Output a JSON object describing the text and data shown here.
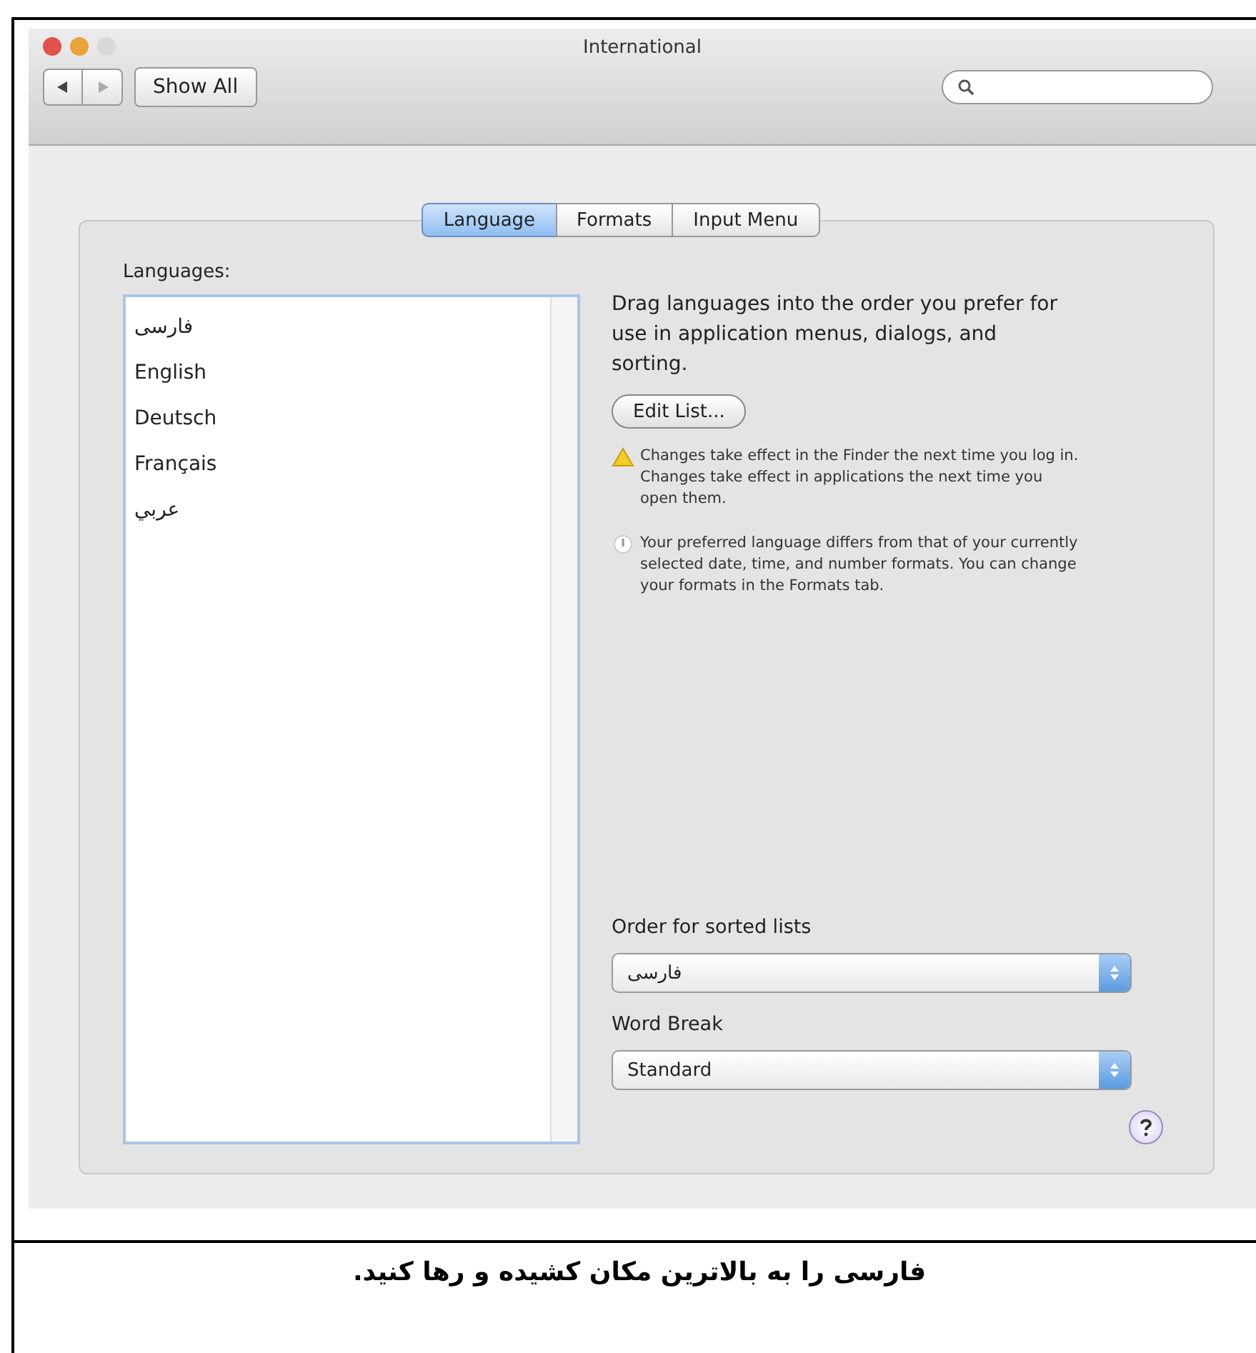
{
  "window": {
    "title": "International",
    "traffic_lights": [
      {
        "color": "#e0524a"
      },
      {
        "color": "#e8a33a"
      },
      {
        "color": "#d8d8d8"
      }
    ]
  },
  "toolbar": {
    "show_all": "Show All"
  },
  "tabs": [
    {
      "label": "Language",
      "selected": true
    },
    {
      "label": "Formats",
      "selected": false
    },
    {
      "label": "Input Menu",
      "selected": false
    }
  ],
  "languages_label": "Languages:",
  "languages": [
    "فارسی",
    "English",
    "Deutsch",
    "Français",
    "عربي"
  ],
  "description": "Drag languages into the order you prefer for use in application menus, dialogs, and sorting.",
  "edit_button": "Edit List...",
  "notes": [
    {
      "kind": "warning",
      "text": "Changes take effect in the Finder the next time you log in. Changes take effect in applications the next time you open them."
    },
    {
      "kind": "info",
      "text": "Your preferred language differs from that of your currently selected date, time, and number formats. You can change your formats in the Formats tab."
    }
  ],
  "selects": [
    {
      "label": "Order for sorted lists",
      "value": "فارسی"
    },
    {
      "label": "Word Break",
      "value": "Standard"
    }
  ],
  "caption": "فارسی را به بالاترین مکان کشیده و رها کنید."
}
